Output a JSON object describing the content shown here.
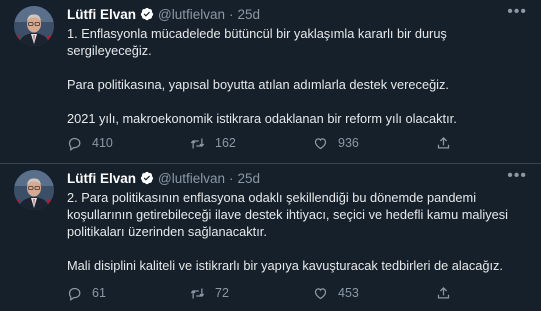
{
  "tweets": [
    {
      "author": {
        "name": "Lütfi Elvan",
        "handle": "@lutfielvan"
      },
      "time": "25d",
      "paragraphs": [
        "1. Enflasyonla mücadelede bütüncül bir yaklaşımla kararlı bir duruş sergileyeceğiz.",
        "Para politikasına, yapısal boyutta atılan adımlarla destek vereceğiz.",
        "2021 yılı, makroekonomik istikrara odaklanan bir reform yılı olacaktır."
      ],
      "stats": {
        "replies": "410",
        "retweets": "162",
        "likes": "936"
      }
    },
    {
      "author": {
        "name": "Lütfi Elvan",
        "handle": "@lutfielvan"
      },
      "time": "25d",
      "paragraphs": [
        "2. Para politikasının enflasyona odaklı şekillendiği bu dönemde pandemi koşullarının getirebileceği ilave destek ihtiyacı, seçici ve hedefli kamu maliyesi politikaları üzerinden sağlanacaktır.",
        "Mali disiplini kaliteli ve istikrarlı bir yapıya kavuşturacak tedbirleri de alacağız."
      ],
      "stats": {
        "replies": "61",
        "retweets": "72",
        "likes": "453"
      }
    }
  ],
  "icons": {
    "verified": "verified-badge-icon",
    "more": "more-options-icon",
    "reply": "reply-icon",
    "retweet": "retweet-icon",
    "like": "heart-icon",
    "share": "share-icon"
  },
  "colors": {
    "background": "#15202b",
    "text": "#e7e9ea",
    "muted": "#8b98a5",
    "divider": "#38444d",
    "verified": "#ffffff"
  }
}
